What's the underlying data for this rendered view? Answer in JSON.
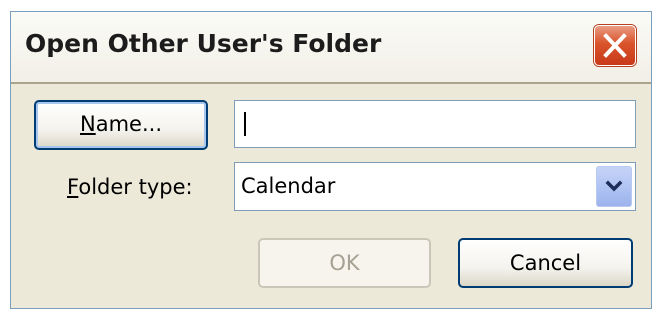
{
  "dialog": {
    "title": "Open Other User's Folder",
    "close_label": "Close"
  },
  "name_button": {
    "label_mnemonic": "N",
    "label_rest": "ame..."
  },
  "name_input": {
    "value": ""
  },
  "folder_type": {
    "label_mnemonic": "F",
    "label_rest": "older type:",
    "selected": "Calendar"
  },
  "buttons": {
    "ok": "OK",
    "cancel": "Cancel"
  },
  "colors": {
    "dialog_bg": "#ece9d8",
    "close_red": "#d9542b",
    "button_border": "#003c74",
    "disabled_text": "#a5a293"
  },
  "icons": {
    "close": "close-icon",
    "dropdown": "chevron-down-icon"
  }
}
